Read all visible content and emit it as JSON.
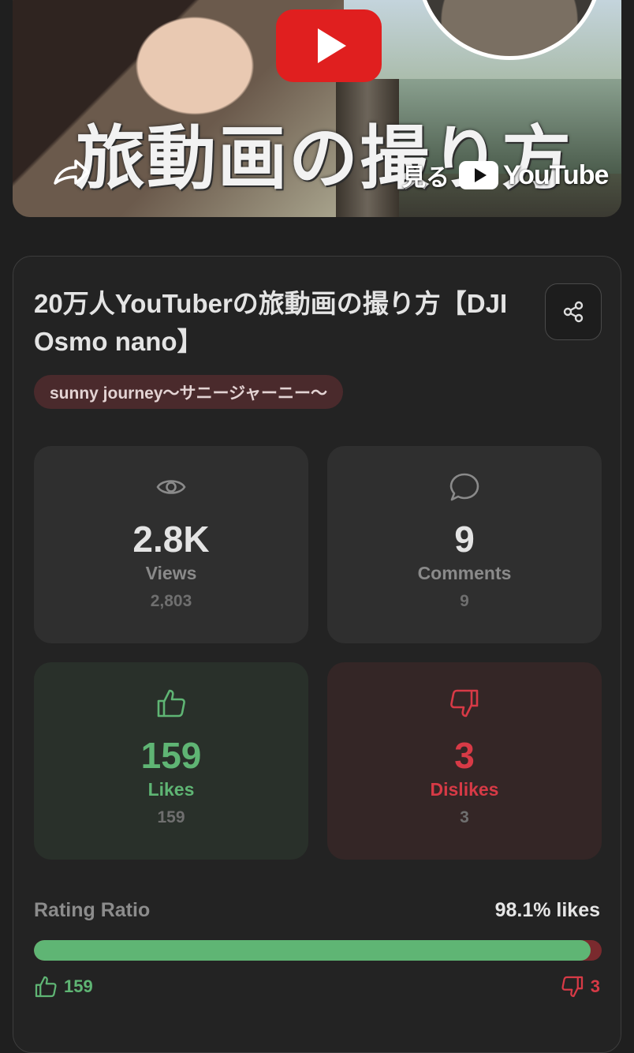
{
  "thumbnail": {
    "overlay_title": "旅動画の撮り方",
    "watch_label": "見る",
    "youtube_label": "YouTube"
  },
  "video": {
    "title": "20万人YouTuberの旅動画の撮り方【DJI Osmo nano】",
    "channel": "sunny journey〜サニージャーニー〜"
  },
  "stats": {
    "views": {
      "short": "2.8K",
      "label": "Views",
      "raw": "2,803"
    },
    "comments": {
      "short": "9",
      "label": "Comments",
      "raw": "9"
    },
    "likes": {
      "short": "159",
      "label": "Likes",
      "raw": "159"
    },
    "dislikes": {
      "short": "3",
      "label": "Dislikes",
      "raw": "3"
    }
  },
  "rating": {
    "label": "Rating Ratio",
    "value_text": "98.1% likes",
    "like_fraction": 0.981,
    "likes": "159",
    "dislikes": "3"
  },
  "colors": {
    "background": "#1f1f1f",
    "card": "#232323",
    "green": "#5fb574",
    "red": "#d73a46",
    "youtube_red": "#e01f1f"
  },
  "icons": [
    "share-arrow-icon",
    "youtube-play-icon",
    "share-icon",
    "eye-icon",
    "comment-icon",
    "thumbs-up-icon",
    "thumbs-down-icon"
  ]
}
